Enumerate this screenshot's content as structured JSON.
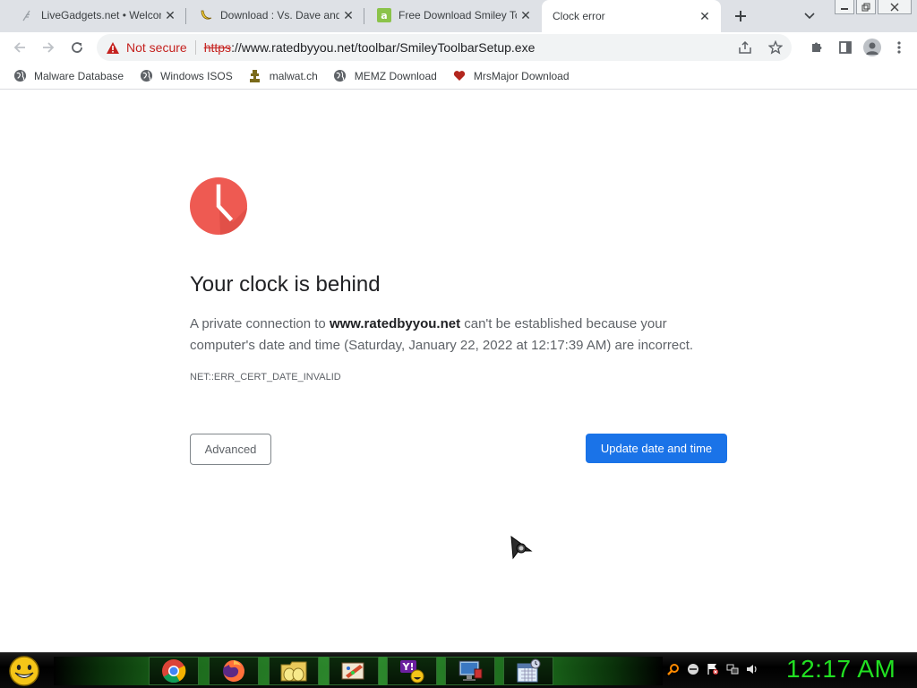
{
  "browser": {
    "tabs": [
      {
        "title": "LiveGadgets.net • Welcome",
        "favicon": "feather-icon",
        "active": false
      },
      {
        "title": "Download : Vs. Dave and",
        "favicon": "banana-icon",
        "active": false
      },
      {
        "title": "Free Download Smiley Toolbar",
        "favicon": "green-a-icon",
        "active": false
      },
      {
        "title": "Clock error",
        "favicon": "none",
        "active": true
      }
    ],
    "newtab_icon": "plus-icon",
    "tabsearch_icon": "chevron-down-icon",
    "window_controls": [
      "minimize",
      "restore",
      "close"
    ]
  },
  "omnibox": {
    "security_label": "Not secure",
    "url_scheme": "https",
    "url_rest": "://www.ratedbyyou.net/toolbar/SmileyToolbarSetup.exe",
    "security_color": "#c5221f"
  },
  "bookmarks": [
    {
      "label": "Malware Database",
      "icon": "globe-icon"
    },
    {
      "label": "Windows ISOS",
      "icon": "globe-icon"
    },
    {
      "label": "malwat.ch",
      "icon": "trophy-icon"
    },
    {
      "label": "MEMZ Download",
      "icon": "globe-icon"
    },
    {
      "label": "MrsMajor Download",
      "icon": "heart-icon"
    }
  ],
  "page": {
    "heading": "Your clock is behind",
    "desc_prefix": "A private connection to ",
    "desc_host": "www.ratedbyyou.net",
    "desc_suffix": " can't be established because your computer's date and time (Saturday, January 22, 2022 at 12:17:39 AM) are incorrect.",
    "error_code": "NET::ERR_CERT_DATE_INVALID",
    "advanced_label": "Advanced",
    "update_label": "Update date and time",
    "accent_color": "#1a73e8",
    "clock_icon_color": "#ee5a52"
  },
  "taskbar": {
    "start_icon": "smiley-icon",
    "apps": [
      "chrome-icon",
      "firefox-icon",
      "folder-icon",
      "paint-icon",
      "yahoo-messenger-icon",
      "computer-icon",
      "calendar-icon"
    ],
    "tray": [
      "search-icon",
      "minus-circle-icon",
      "flag-icon",
      "network-icon",
      "volume-icon"
    ],
    "clock": "12:17 AM",
    "clock_color": "#22e022"
  }
}
